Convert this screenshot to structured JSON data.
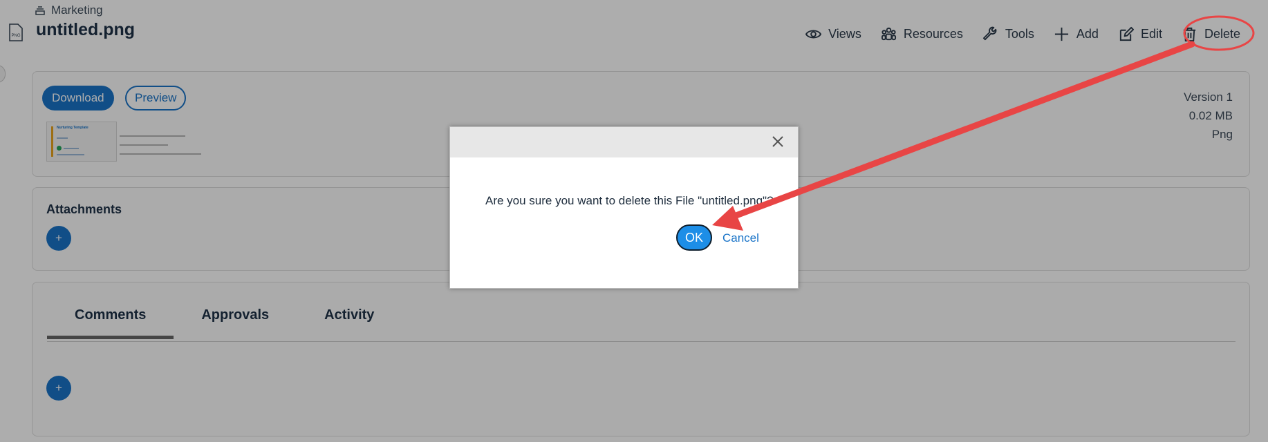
{
  "header": {
    "breadcrumb": "Marketing",
    "file_badge": "PNG",
    "title": "untitled.png",
    "toolbar": {
      "views": "Views",
      "resources": "Resources",
      "tools": "Tools",
      "add": "Add",
      "edit": "Edit",
      "delete": "Delete"
    }
  },
  "file_card": {
    "download": "Download",
    "preview": "Preview",
    "thumbnail_title": "Nurturing Template",
    "version_label": "Version 1",
    "size": "0.02 MB",
    "type": "Png"
  },
  "attachments": {
    "title": "Attachments",
    "add": "+"
  },
  "tabs": {
    "items": [
      "Comments",
      "Approvals",
      "Activity"
    ],
    "add": "+"
  },
  "dialog": {
    "message": "Are you sure you want to delete this File \"untitled.png\"?",
    "ok": "OK",
    "cancel": "Cancel"
  },
  "colors": {
    "primary": "#1a74c8",
    "ok_button": "#1d8ee7",
    "annotation": "#e84545",
    "overlay": "rgba(0,0,0,0.32)"
  }
}
